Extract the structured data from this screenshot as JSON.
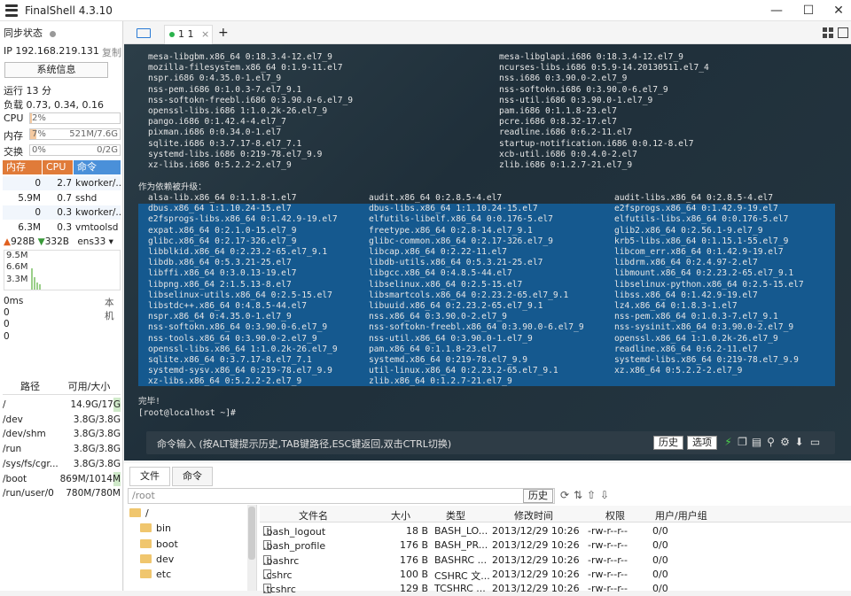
{
  "window": {
    "title": "FinalShell 4.3.10",
    "controls": [
      "—",
      "☐",
      "✕"
    ]
  },
  "sidebar": {
    "sync_label": "同步状态",
    "ip_label": "IP",
    "ip": "192.168.219.131",
    "copy": "复制",
    "sysinfo_btn": "系统信息",
    "uptime": "运行 13 分",
    "load": "负载 0.73, 0.34, 0.16",
    "cpu": {
      "label": "CPU",
      "value": "2%",
      "fraction": 0.02
    },
    "mem": {
      "label": "内存",
      "value": "7%",
      "detail": "521M/7.6G",
      "fraction": 0.07
    },
    "swap": {
      "label": "交换",
      "value": "0%",
      "detail": "0/2G",
      "fraction": 0.0
    },
    "proc_headers": [
      "内存",
      "CPU",
      "命令"
    ],
    "processes": [
      {
        "mem": "0",
        "cpu": "2.7",
        "cmd": "kworker/..."
      },
      {
        "mem": "5.9M",
        "cpu": "0.7",
        "cmd": "sshd"
      },
      {
        "mem": "0",
        "cpu": "0.3",
        "cmd": "kworker/..."
      },
      {
        "mem": "6.3M",
        "cpu": "0.3",
        "cmd": "vmtoolsd"
      }
    ],
    "net": {
      "up": "928B",
      "down": "332B",
      "iface": "ens33",
      "graph_labels": [
        "9.5M",
        "6.6M",
        "3.3M"
      ]
    },
    "latency": {
      "ms": "0ms",
      "host": "本机",
      "values": [
        "0",
        "0",
        "0"
      ]
    },
    "disk_headers": [
      "路径",
      "可用/大小"
    ],
    "disks": [
      {
        "path": "/",
        "size": "14.9G/17G"
      },
      {
        "path": "/dev",
        "size": "3.8G/3.8G"
      },
      {
        "path": "/dev/shm",
        "size": "3.8G/3.8G"
      },
      {
        "path": "/run",
        "size": "3.8G/3.8G"
      },
      {
        "path": "/sys/fs/cgr...",
        "size": "3.8G/3.8G"
      },
      {
        "path": "/boot",
        "size": "869M/1014M"
      },
      {
        "path": "/run/user/0",
        "size": "780M/780M"
      }
    ]
  },
  "tabs": {
    "session": "1 1",
    "close": "×",
    "add": "+"
  },
  "terminal": {
    "top_left": [
      "mesa-libgbm.x86_64 0:18.3.4-12.el7_9",
      "mozilla-filesystem.x86_64 0:1.9-11.el7",
      "nspr.i686 0:4.35.0-1.el7_9",
      "nss-pem.i686 0:1.0.3-7.el7_9.1",
      "nss-softokn-freebl.i686 0:3.90.0-6.el7_9",
      "openssl-libs.i686 1:1.0.2k-26.el7_9",
      "pango.i686 0:1.42.4-4.el7_7",
      "pixman.i686 0:0.34.0-1.el7",
      "sqlite.i686 0:3.7.17-8.el7_7.1",
      "systemd-libs.i686 0:219-78.el7_9.9",
      "xz-libs.i686 0:5.2.2-2.el7_9"
    ],
    "top_right": [
      "mesa-libglapi.i686 0:18.3.4-12.el7_9",
      "ncurses-libs.i686 0:5.9-14.20130511.el7_4",
      "nss.i686 0:3.90.0-2.el7_9",
      "nss-softokn.i686 0:3.90.0-6.el7_9",
      "nss-util.i686 0:3.90.0-1.el7_9",
      "pam.i686 0:1.1.8-23.el7",
      "pcre.i686 0:8.32-17.el7",
      "readline.i686 0:6.2-11.el7",
      "startup-notification.i686 0:0.12-8.el7",
      "xcb-util.i686 0:0.4.0-2.el7",
      "zlib.i686 0:1.2.7-21.el7_9"
    ],
    "dep_heading": "作为依赖被升级：",
    "col1": [
      "alsa-lib.x86_64 0:1.1.8-1.el7",
      "dbus.x86_64 1:1.10.24-15.el7",
      "e2fsprogs-libs.x86_64 0:1.42.9-19.el7",
      "expat.x86_64 0:2.1.0-15.el7_9",
      "glibc.x86_64 0:2.17-326.el7_9",
      "libblkid.x86_64 0:2.23.2-65.el7_9.1",
      "libdb.x86_64 0:5.3.21-25.el7",
      "libffi.x86_64 0:3.0.13-19.el7",
      "libpng.x86_64 2:1.5.13-8.el7",
      "libselinux-utils.x86_64 0:2.5-15.el7",
      "libstdc++.x86_64 0:4.8.5-44.el7",
      "nspr.x86_64 0:4.35.0-1.el7_9",
      "nss-softokn.x86_64 0:3.90.0-6.el7_9",
      "nss-tools.x86_64 0:3.90.0-2.el7_9",
      "openssl-libs.x86_64 1:1.0.2k-26.el7_9",
      "sqlite.x86_64 0:3.7.17-8.el7_7.1",
      "systemd-sysv.x86_64 0:219-78.el7_9.9",
      "xz-libs.x86_64 0:5.2.2-2.el7_9"
    ],
    "col2": [
      "audit.x86_64 0:2.8.5-4.el7",
      "dbus-libs.x86_64 1:1.10.24-15.el7",
      "elfutils-libelf.x86_64 0:0.176-5.el7",
      "freetype.x86_64 0:2.8-14.el7_9.1",
      "glibc-common.x86_64 0:2.17-326.el7_9",
      "libcap.x86_64 0:2.22-11.el7",
      "libdb-utils.x86_64 0:5.3.21-25.el7",
      "libgcc.x86_64 0:4.8.5-44.el7",
      "libselinux.x86_64 0:2.5-15.el7",
      "libsmartcols.x86_64 0:2.23.2-65.el7_9.1",
      "libuuid.x86_64 0:2.23.2-65.el7_9.1",
      "nss.x86_64 0:3.90.0-2.el7_9",
      "nss-softokn-freebl.x86_64 0:3.90.0-6.el7_9",
      "nss-util.x86_64 0:3.90.0-1.el7_9",
      "pam.x86_64 0:1.1.8-23.el7",
      "systemd.x86_64 0:219-78.el7_9.9",
      "util-linux.x86_64 0:2.23.2-65.el7_9.1",
      "zlib.x86_64 0:1.2.7-21.el7_9"
    ],
    "col3": [
      "audit-libs.x86_64 0:2.8.5-4.el7",
      "e2fsprogs.x86_64 0:1.42.9-19.el7",
      "elfutils-libs.x86_64 0:0.176-5.el7",
      "glib2.x86_64 0:2.56.1-9.el7_9",
      "krb5-libs.x86_64 0:1.15.1-55.el7_9",
      "libcom_err.x86_64 0:1.42.9-19.el7",
      "libdrm.x86_64 0:2.4.97-2.el7",
      "libmount.x86_64 0:2.23.2-65.el7_9.1",
      "libselinux-python.x86_64 0:2.5-15.el7",
      "libss.x86_64 0:1.42.9-19.el7",
      "lz4.x86_64 0:1.8.3-1.el7",
      "nss-pem.x86_64 0:1.0.3-7.el7_9.1",
      "nss-sysinit.x86_64 0:3.90.0-2.el7_9",
      "openssl.x86_64 1:1.0.2k-26.el7_9",
      "readline.x86_64 0:6.2-11.el7",
      "systemd-libs.x86_64 0:219-78.el7_9.9",
      "xz.x86_64 0:5.2.2-2.el7_9"
    ],
    "done": "完毕!",
    "prompt": "[root@localhost ~]#"
  },
  "cmdbar": {
    "hint": "命令输入 (按ALT键提示历史,TAB键路径,ESC键返回,双击CTRL切换)",
    "history": "历史",
    "options": "选项"
  },
  "bottom": {
    "tabs": [
      "文件",
      "命令"
    ],
    "path": "/root",
    "history": "历史",
    "tree": [
      "/",
      "bin",
      "boot",
      "dev",
      "etc"
    ],
    "columns": [
      "文件名",
      "大小",
      "类型",
      "修改时间",
      "权限",
      "用户/用户组"
    ],
    "files": [
      {
        "name": ".bash_logout",
        "size": "18 B",
        "type": "BASH_LO...",
        "mtime": "2013/12/29 10:26",
        "perm": "-rw-r--r--",
        "owner": "0/0"
      },
      {
        "name": ".bash_profile",
        "size": "176 B",
        "type": "BASH_PR...",
        "mtime": "2013/12/29 10:26",
        "perm": "-rw-r--r--",
        "owner": "0/0"
      },
      {
        "name": ".bashrc",
        "size": "176 B",
        "type": "BASHRC ...",
        "mtime": "2013/12/29 10:26",
        "perm": "-rw-r--r--",
        "owner": "0/0"
      },
      {
        "name": ".cshrc",
        "size": "100 B",
        "type": "CSHRC 文...",
        "mtime": "2013/12/29 10:26",
        "perm": "-rw-r--r--",
        "owner": "0/0"
      },
      {
        "name": ".tcshrc",
        "size": "129 B",
        "type": "TCSHRC ...",
        "mtime": "2013/12/29 10:26",
        "perm": "-rw-r--r--",
        "owner": "0/0"
      }
    ]
  }
}
